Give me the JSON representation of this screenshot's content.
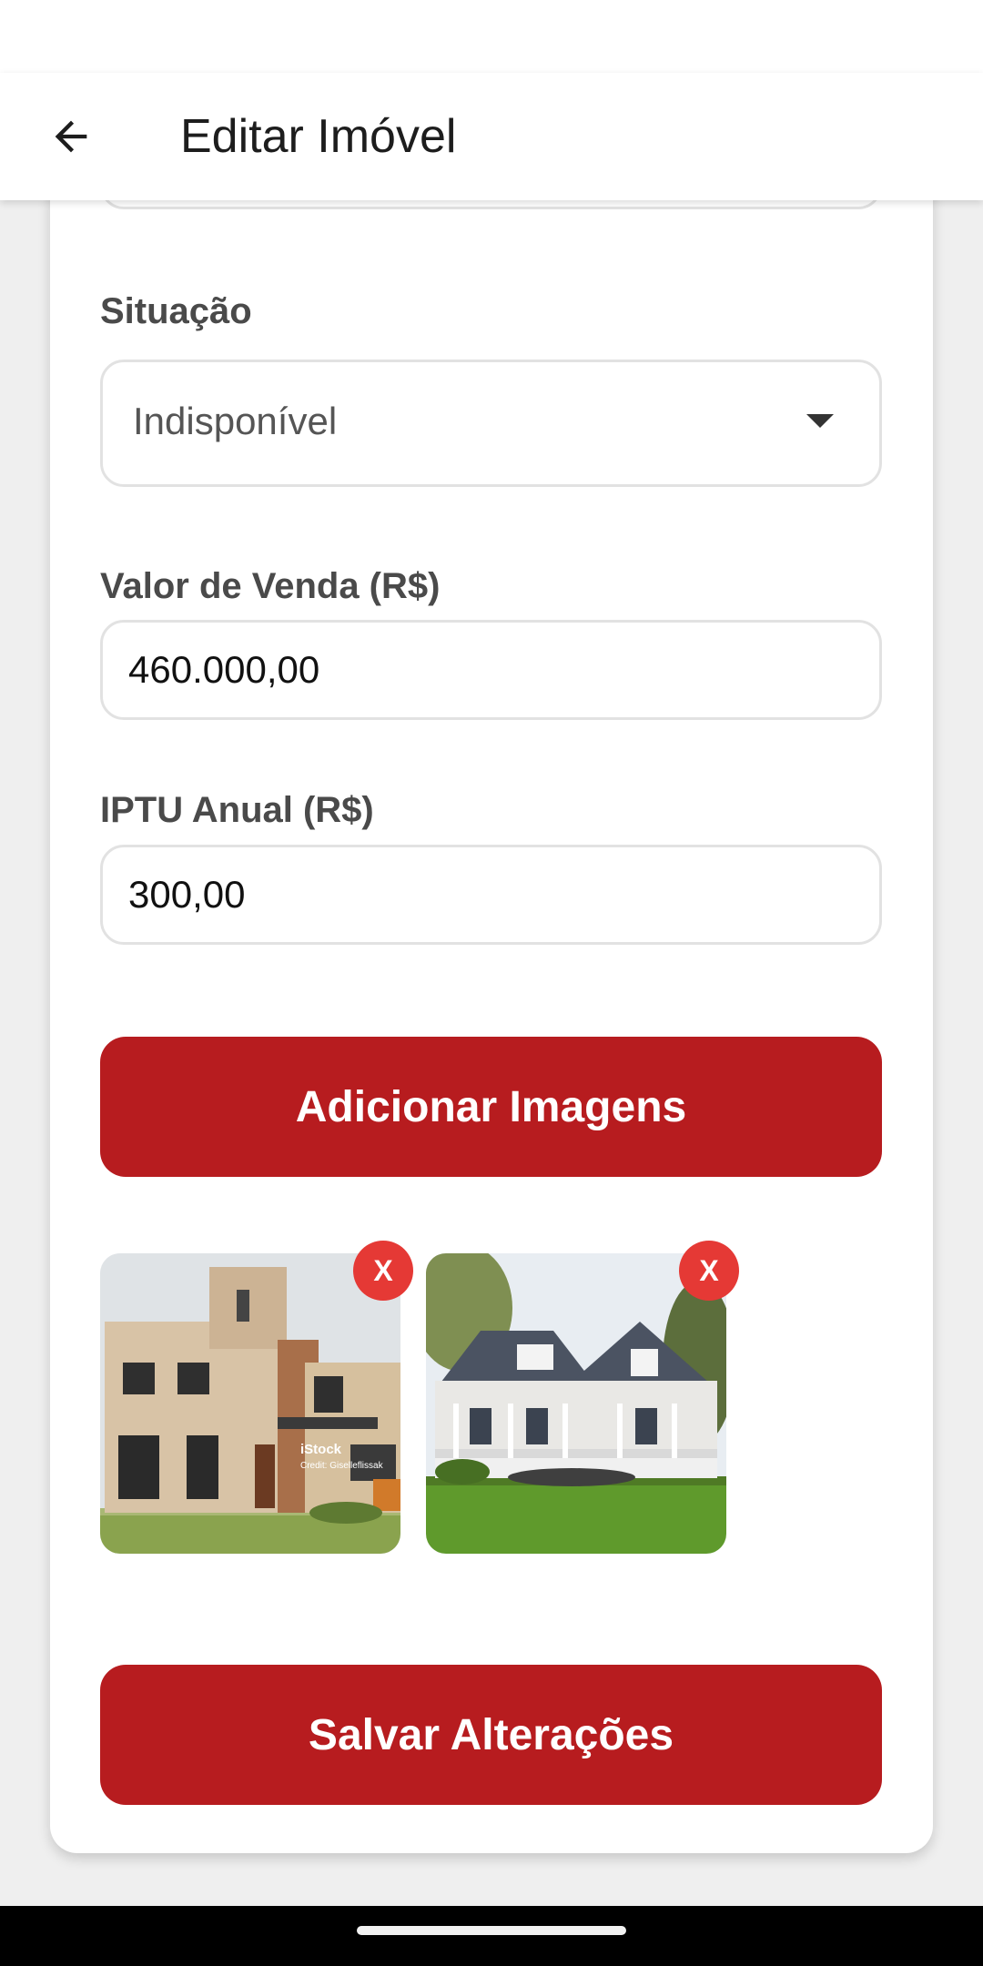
{
  "app_bar": {
    "title": "Editar Imóvel",
    "back_icon": "arrow-left-icon"
  },
  "form": {
    "situacao": {
      "label": "Situação",
      "value": "Indisponível"
    },
    "valor_venda": {
      "label": "Valor de Venda (R$)",
      "value": "460.000,00"
    },
    "iptu": {
      "label": "IPTU Anual (R$)",
      "value": "300,00"
    }
  },
  "buttons": {
    "add_images": "Adicionar Imagens",
    "save": "Salvar Alterações"
  },
  "images": [
    {
      "remove_label": "X",
      "description_icon": "modern-house-photo",
      "watermark": "iStock",
      "credit": "Credit: Giselleflissak"
    },
    {
      "remove_label": "X",
      "description_icon": "colonial-house-photo"
    }
  ],
  "colors": {
    "primary": "#b71c1f",
    "remove": "#e53935"
  }
}
